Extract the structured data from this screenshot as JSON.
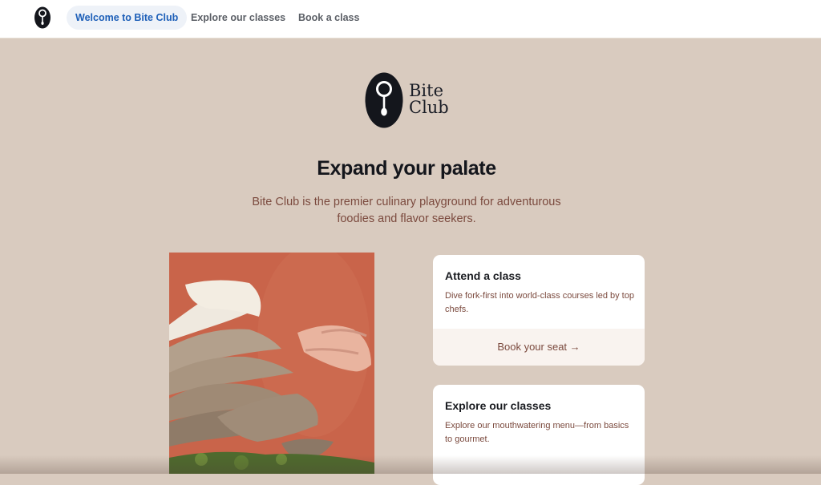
{
  "nav": {
    "tabs": [
      {
        "label": "Welcome to Bite Club",
        "active": true
      },
      {
        "label": "Explore our classes",
        "active": false
      },
      {
        "label": "Book a class",
        "active": false
      }
    ]
  },
  "hero": {
    "brand_line1": "Bite",
    "brand_line2": "Club",
    "headline": "Expand your palate",
    "subtitle": "Bite Club is the premier culinary playground for adventurous foodies and flavor seekers."
  },
  "cards": [
    {
      "title": "Attend a class",
      "description": "Dive fork-first into world-class courses led by top chefs.",
      "cta": "Book your seat →"
    },
    {
      "title": "Explore our classes",
      "description": "Explore our mouthwatering menu—from basics to gourmet."
    }
  ],
  "colors": {
    "page_background": "#d9cbbf",
    "accent_text": "#7b4a3e",
    "active_tab": "#1d5fb8",
    "image_background": "#c9644a",
    "logo": "#14161c"
  },
  "icons": {
    "logo": "spoon-logo-icon",
    "cta_arrow": "arrow-right-icon"
  }
}
